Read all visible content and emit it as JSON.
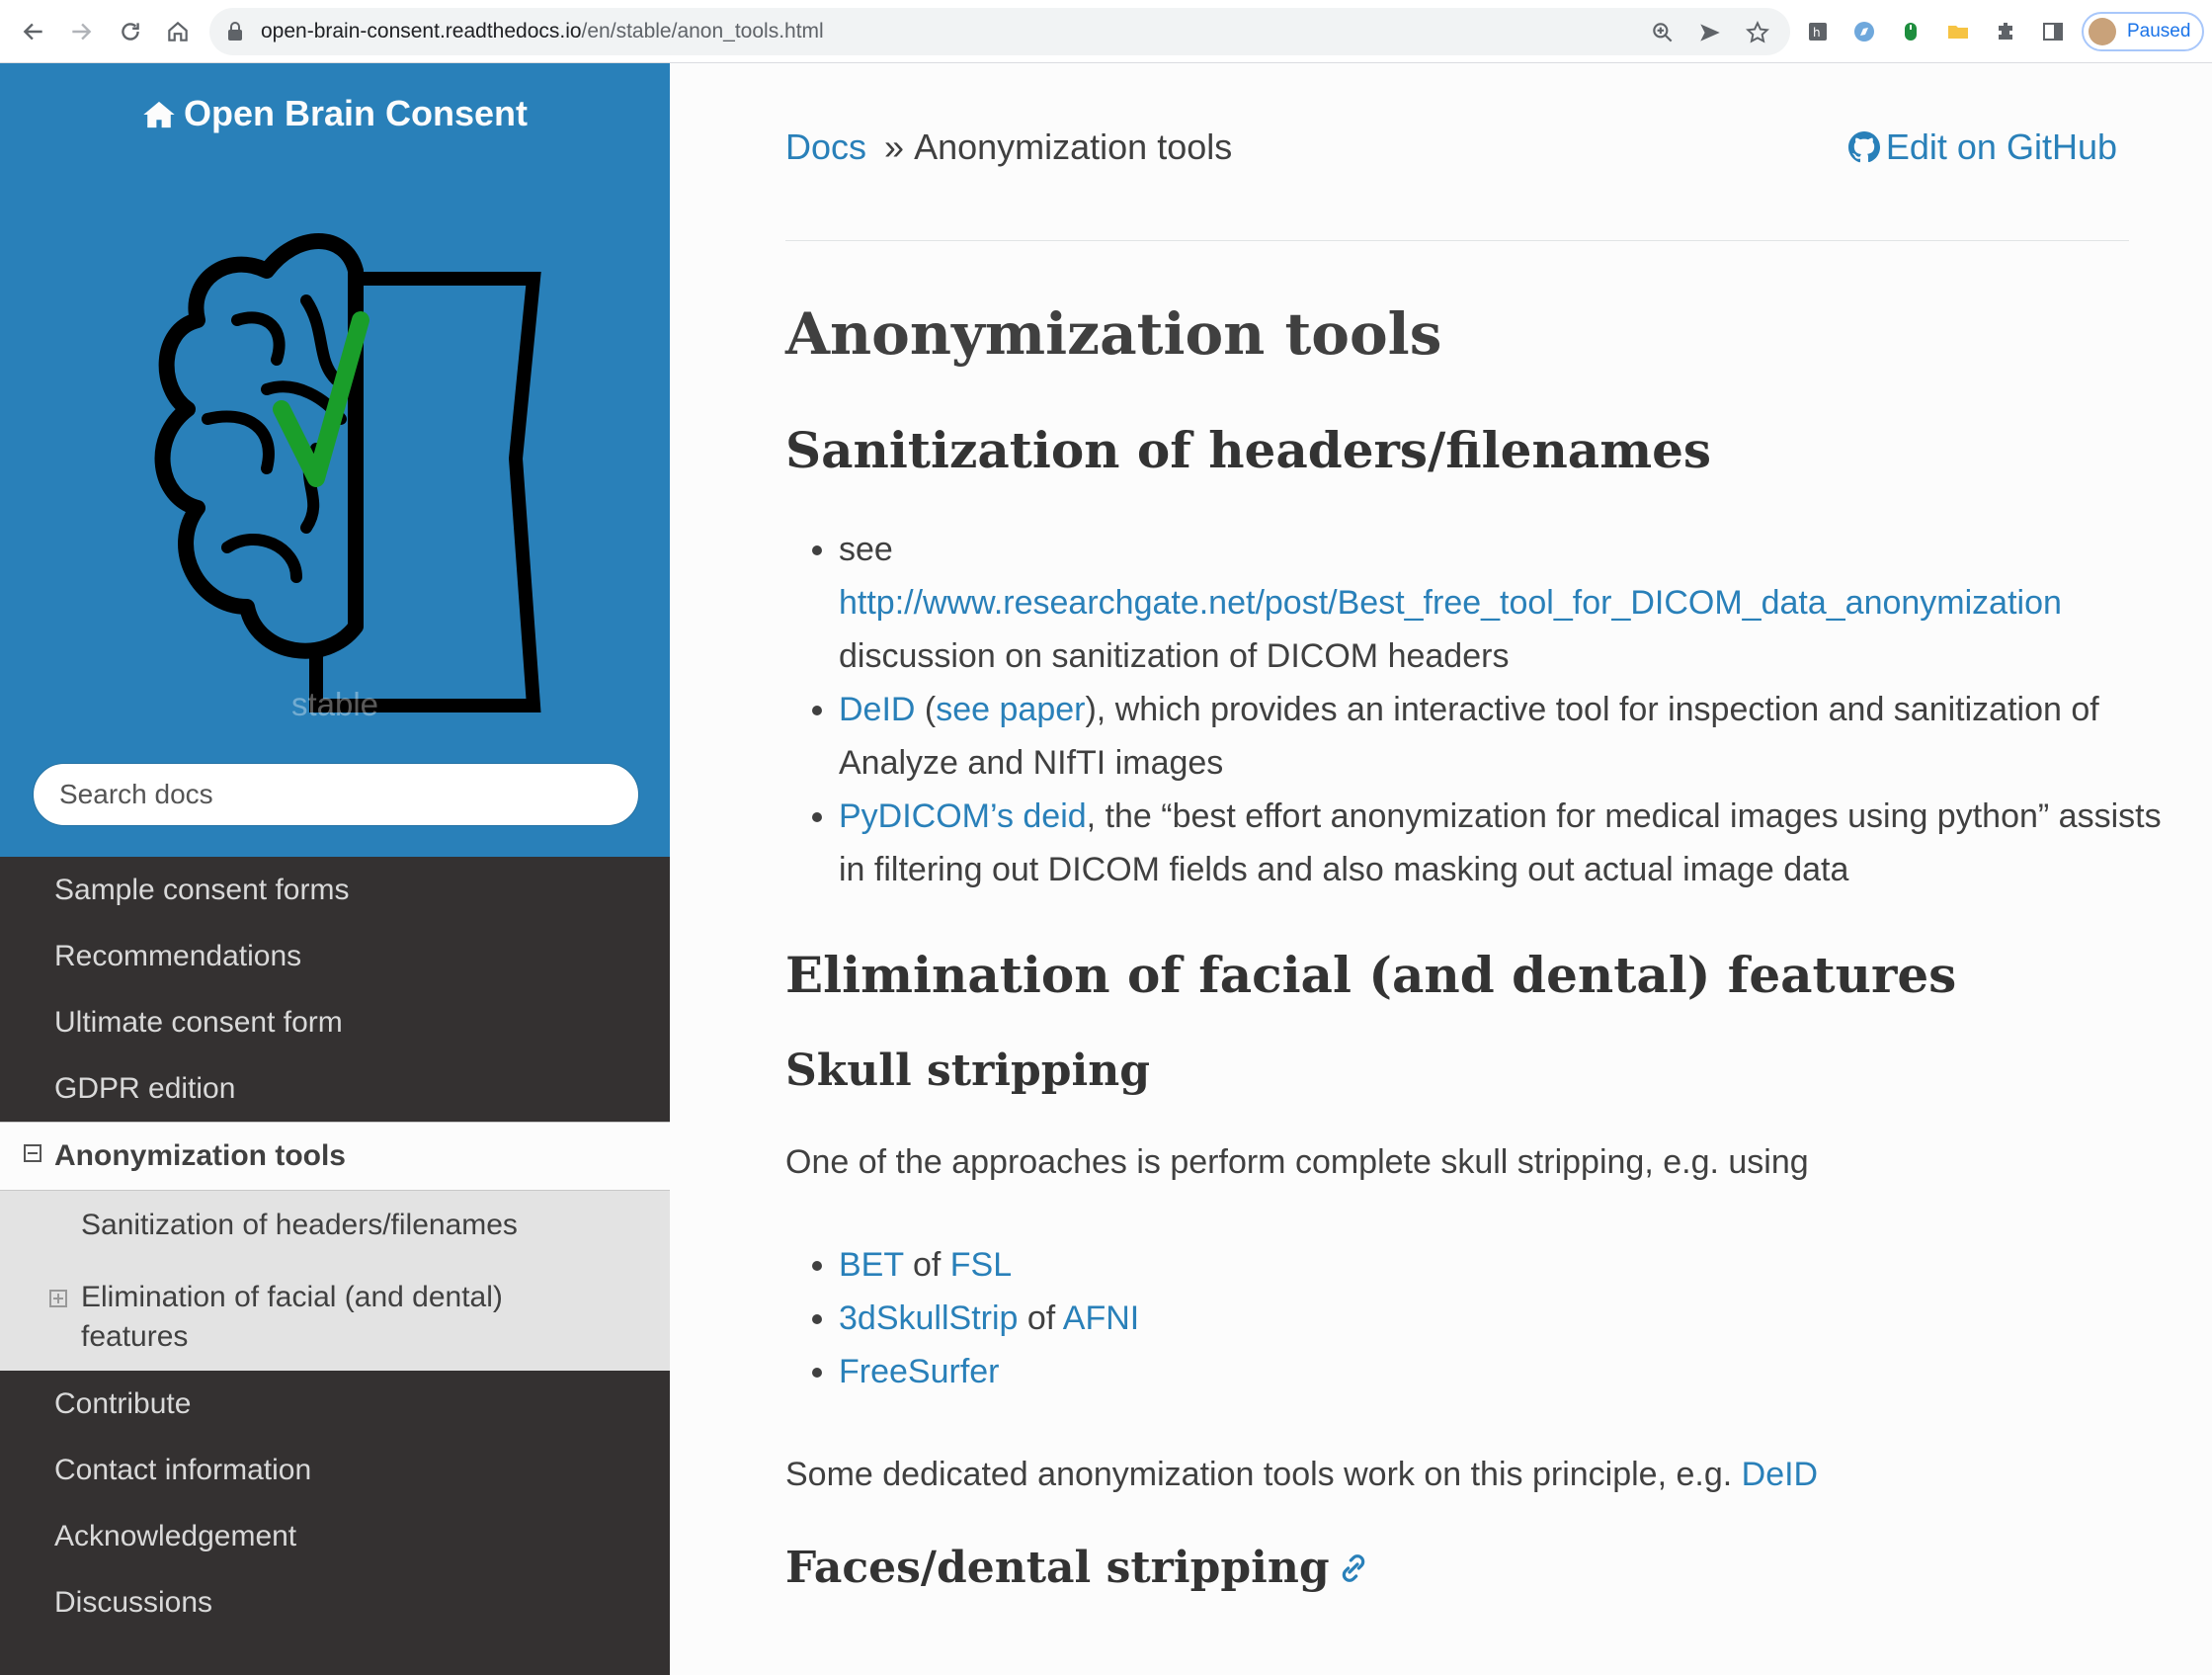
{
  "browser": {
    "url_host": "open-brain-consent.readthedocs.io",
    "url_path": "/en/stable/anon_tools.html",
    "profile_label": "Paused"
  },
  "sidebar": {
    "title": "Open Brain Consent",
    "version": "stable",
    "search_placeholder": "Search docs",
    "items_before": [
      {
        "label": "Sample consent forms"
      },
      {
        "label": "Recommendations"
      },
      {
        "label": "Ultimate consent form"
      },
      {
        "label": "GDPR edition"
      }
    ],
    "current": {
      "label": "Anonymization tools",
      "children": [
        {
          "label": "Sanitization of headers/filenames"
        },
        {
          "label": "Elimination of facial (and dental) features"
        }
      ]
    },
    "items_after": [
      {
        "label": "Contribute"
      },
      {
        "label": "Contact information"
      },
      {
        "label": "Acknowledgement"
      },
      {
        "label": "Discussions"
      }
    ]
  },
  "breadcrumb": {
    "docs": "Docs",
    "separator": "»",
    "current": "Anonymization tools",
    "edit": "Edit on GitHub"
  },
  "page": {
    "title": "Anonymization tools",
    "section1": {
      "heading": "Sanitization of headers/filenames",
      "bullet1": {
        "pre": "see",
        "link": "http://www.researchgate.net/post/Best_free_tool_for_DICOM_data_anonymization",
        "post": "discussion on sanitization of DICOM headers"
      },
      "bullet2": {
        "link1": "DeID",
        "open": " (",
        "link2": "see paper",
        "post": "), which provides an interactive tool for inspection and sanitization of Analyze and NIfTI images"
      },
      "bullet3": {
        "link": "PyDICOM’s deid",
        "post": ", the “best effort anonymization for medical images using python” assists in filtering out DICOM fields and also masking out actual image data"
      }
    },
    "section2": {
      "heading": "Elimination of facial (and dental) features",
      "sub1": {
        "heading": "Skull stripping",
        "intro": "One of the approaches is perform complete skull stripping, e.g. using",
        "items": [
          {
            "a": "BET",
            "mid": " of ",
            "b": "FSL"
          },
          {
            "a": "3dSkullStrip",
            "mid": " of ",
            "b": "AFNI"
          },
          {
            "a": "FreeSurfer",
            "mid": "",
            "b": ""
          }
        ],
        "note_pre": "Some dedicated anonymization tools work on this principle, e.g. ",
        "note_link": "DeID"
      },
      "sub2": {
        "heading": "Faces/dental stripping"
      }
    }
  },
  "colors": {
    "sidebar_top": "#2980b9",
    "sidebar_menu": "#343131",
    "link": "#2980b9",
    "checkmark": "#1a9e2a"
  }
}
